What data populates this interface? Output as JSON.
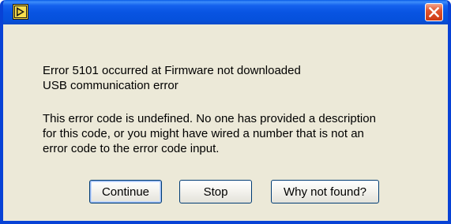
{
  "window": {
    "title": "",
    "icon": "labview-run-arrow-icon",
    "close_icon": "close-icon",
    "accent_color": "#0842d6",
    "close_color": "#d8522b"
  },
  "message": {
    "line1": "Error 5101 occurred at Firmware not downloaded",
    "line2": "USB communication error",
    "line3": "This error code is undefined. No one has provided a description",
    "line4": "for this code, or you might have wired a number that is not an",
    "line5": "error code to the error code input."
  },
  "buttons": {
    "continue": "Continue",
    "stop": "Stop",
    "why_not_found": "Why not found?"
  }
}
